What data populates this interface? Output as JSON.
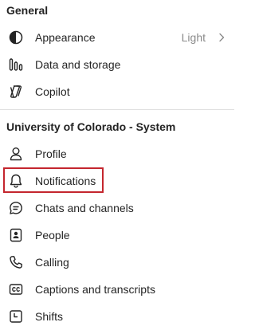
{
  "sections": {
    "general": {
      "title": "General",
      "items": [
        {
          "label": "Appearance",
          "value": "Light",
          "icon": "half-circle-contrast-icon"
        },
        {
          "label": "Data and storage",
          "icon": "data-bars-icon"
        },
        {
          "label": "Copilot",
          "icon": "copilot-icon"
        }
      ]
    },
    "org": {
      "title": "University of Colorado - System",
      "items": [
        {
          "label": "Profile",
          "icon": "person-icon"
        },
        {
          "label": "Notifications",
          "icon": "bell-icon",
          "highlighted": true
        },
        {
          "label": "Chats and channels",
          "icon": "chat-icon"
        },
        {
          "label": "People",
          "icon": "contact-card-icon"
        },
        {
          "label": "Calling",
          "icon": "phone-icon"
        },
        {
          "label": "Captions and transcripts",
          "icon": "closed-captions-icon"
        },
        {
          "label": "Shifts",
          "icon": "shifts-calendar-icon"
        }
      ]
    }
  },
  "colors": {
    "highlight_border": "#c4262e",
    "text": "#242424",
    "secondary_text": "#8a8a8a",
    "divider": "#e0e0e0"
  }
}
